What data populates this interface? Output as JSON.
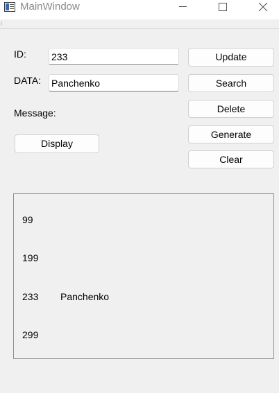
{
  "window": {
    "title": "MainWindow",
    "controls": [
      "minimize-icon",
      "maximize-icon",
      "close-icon"
    ]
  },
  "form": {
    "id_label": "ID:",
    "id_value": "233",
    "data_label": "DATA:",
    "data_value": "Panchenko",
    "message_label": "Message:"
  },
  "buttons": {
    "update": "Update",
    "search": "Search",
    "delete": "Delete",
    "generate": "Generate",
    "clear": "Clear",
    "display": "Display"
  },
  "list": {
    "rows": [
      {
        "id": "99",
        "data": ""
      },
      {
        "id": "199",
        "data": ""
      },
      {
        "id": "233",
        "data": "Panchenko"
      },
      {
        "id": "299",
        "data": ""
      }
    ]
  }
}
